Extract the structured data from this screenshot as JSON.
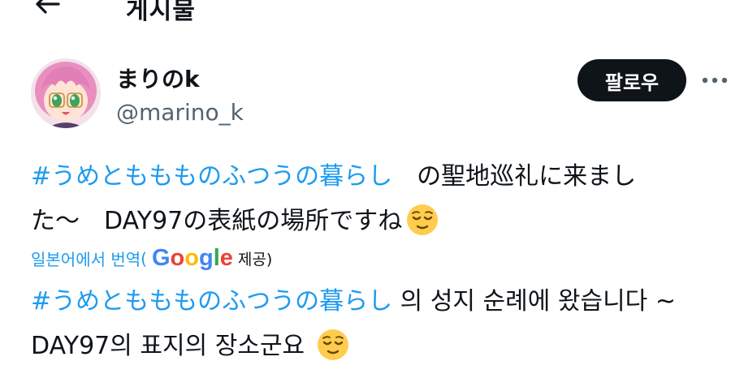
{
  "header": {
    "title": "게시물"
  },
  "author": {
    "display_name": "まりのk",
    "handle": "@marino_k"
  },
  "follow_button": {
    "label": "팔로우"
  },
  "tweet": {
    "hashtag": "#うめとももものふつうの暮らし",
    "line1_rest": "　の聖地巡礼に来まし",
    "line2": "た〜　DAY97の表紙の場所ですね"
  },
  "translation": {
    "label": "일본어에서 번역",
    "paren_open": "(",
    "provider_letters": [
      "G",
      "o",
      "o",
      "g",
      "l",
      "e"
    ],
    "provider_colors": [
      "#4285f4",
      "#ea4335",
      "#fbbc05",
      "#4285f4",
      "#34a853",
      "#ea4335"
    ],
    "provided": "제공)",
    "hashtag": "#うめとももものふつうの暮らし",
    "line1_rest": " 의 성지 순례에 왔습니다 ~",
    "line2": "DAY97의 표지의 장소군요 "
  },
  "icons": {
    "back": "arrow-left-icon",
    "more": "more-horizontal-icon",
    "emoji": "relieved-face-emoji"
  }
}
